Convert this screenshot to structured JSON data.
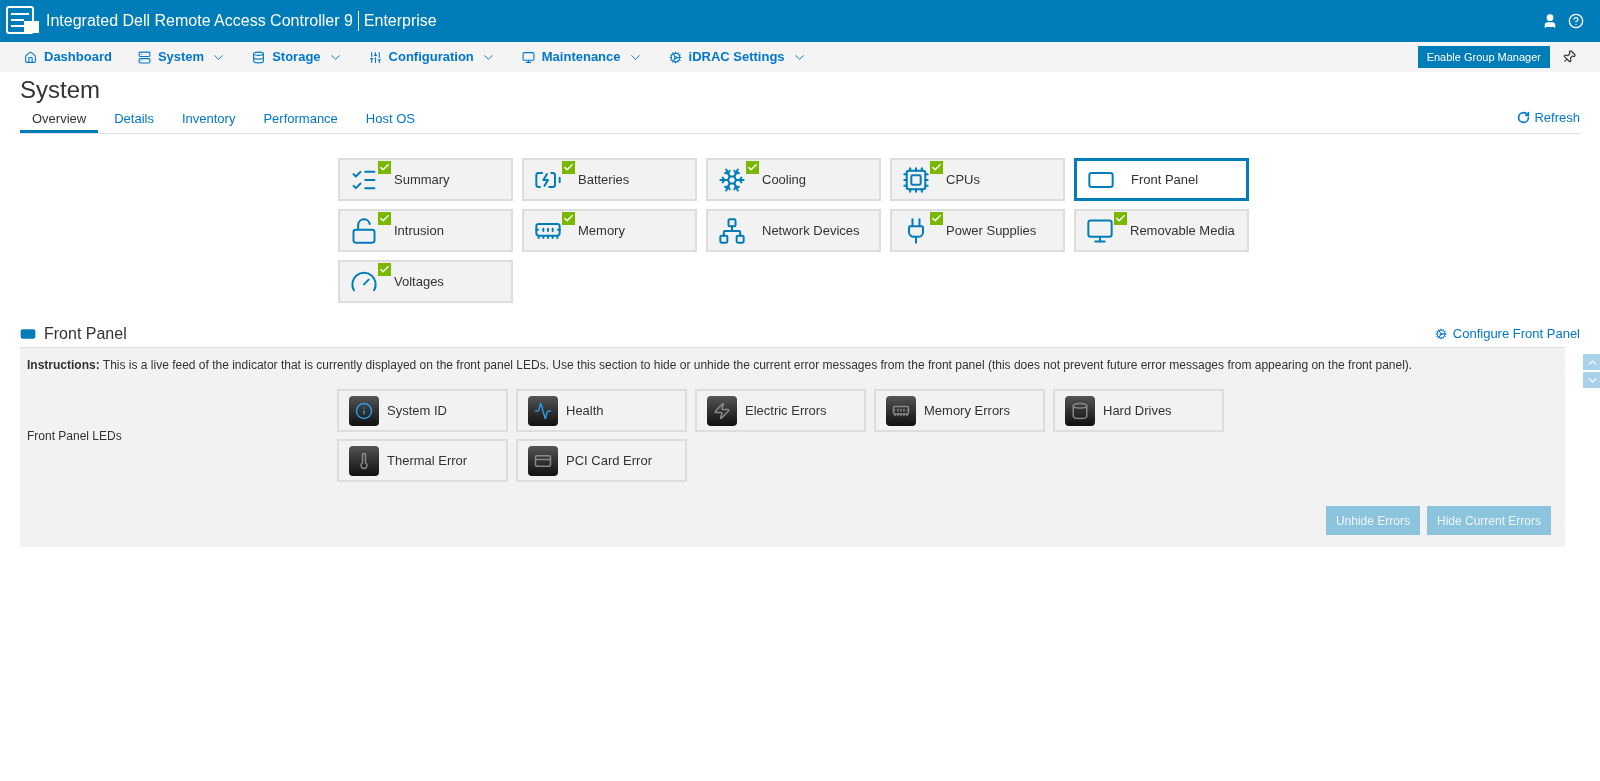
{
  "header": {
    "title": "Integrated Dell Remote Access Controller 9",
    "edition": "Enterprise"
  },
  "nav": [
    {
      "label": "Dashboard",
      "kind": "home",
      "dropdown": false
    },
    {
      "label": "System",
      "kind": "server",
      "dropdown": true
    },
    {
      "label": "Storage",
      "kind": "database",
      "dropdown": true
    },
    {
      "label": "Configuration",
      "kind": "sliders",
      "dropdown": true
    },
    {
      "label": "Maintenance",
      "kind": "monitor",
      "dropdown": true
    },
    {
      "label": "iDRAC Settings",
      "kind": "cogs",
      "dropdown": true
    }
  ],
  "group_manager_button": "Enable Group Manager",
  "page_title": "System",
  "tabs": [
    {
      "label": "Overview",
      "selected": true
    },
    {
      "label": "Details",
      "selected": false
    },
    {
      "label": "Inventory",
      "selected": false
    },
    {
      "label": "Performance",
      "selected": false
    },
    {
      "label": "Host OS",
      "selected": false
    }
  ],
  "refresh": "Refresh",
  "tiles": [
    {
      "label": "Summary",
      "kind": "list",
      "healthy": true,
      "selected": false
    },
    {
      "label": "Batteries",
      "kind": "battery",
      "healthy": true,
      "selected": false
    },
    {
      "label": "Cooling",
      "kind": "snowflake",
      "healthy": true,
      "selected": false
    },
    {
      "label": "CPUs",
      "kind": "cpu",
      "healthy": true,
      "selected": false
    },
    {
      "label": "Front Panel",
      "kind": "panel",
      "healthy": false,
      "selected": true
    },
    {
      "label": "Intrusion",
      "kind": "lock",
      "healthy": true,
      "selected": false
    },
    {
      "label": "Memory",
      "kind": "memory",
      "healthy": true,
      "selected": false
    },
    {
      "label": "Network Devices",
      "kind": "network",
      "healthy": false,
      "selected": false
    },
    {
      "label": "Power Supplies",
      "kind": "plug",
      "healthy": true,
      "selected": false
    },
    {
      "label": "Removable Media",
      "kind": "monitor",
      "healthy": true,
      "selected": false
    },
    {
      "label": "Voltages",
      "kind": "gauge",
      "healthy": true,
      "selected": false
    }
  ],
  "section": {
    "title": "Front Panel",
    "configure_link": "Configure Front Panel",
    "instructions_label": "Instructions:",
    "instructions": "This is a live feed of the indicator that is currently displayed on the front panel LEDs. Use this section to hide or unhide the current error messages from the front panel (this does not prevent future error messages from appearing on the front panel).",
    "leds_label": "Front Panel LEDs",
    "leds": [
      {
        "label": "System ID",
        "kind": "info",
        "lit": true
      },
      {
        "label": "Health",
        "kind": "pulse",
        "lit": true
      },
      {
        "label": "Electric Errors",
        "kind": "zap",
        "lit": false
      },
      {
        "label": "Memory Errors",
        "kind": "chip",
        "lit": false
      },
      {
        "label": "Hard Drives",
        "kind": "drive",
        "lit": false
      },
      {
        "label": "Thermal Error",
        "kind": "thermo",
        "lit": false
      },
      {
        "label": "PCI Card Error",
        "kind": "card",
        "lit": false
      }
    ],
    "buttons": [
      {
        "label": "Unhide Errors",
        "disabled": true
      },
      {
        "label": "Hide Current Errors",
        "disabled": true
      }
    ]
  }
}
